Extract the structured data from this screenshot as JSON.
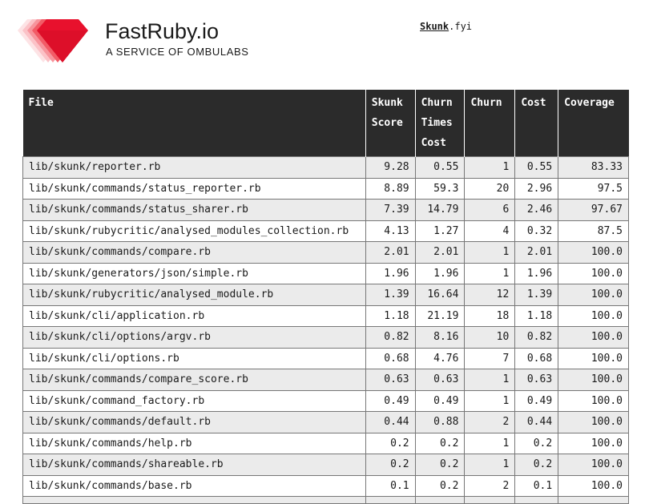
{
  "brand": {
    "name": "FastRuby.io",
    "tagline": "A SERVICE OF OMBULABS"
  },
  "nav": {
    "link_bold": "Skunk",
    "link_rest": ".fyi"
  },
  "table": {
    "headers": {
      "file": "File",
      "skunk_score": "Skunk Score",
      "churn_times_cost": "Churn Times Cost",
      "churn": "Churn",
      "cost": "Cost",
      "coverage": "Coverage"
    },
    "rows": [
      {
        "file": "lib/skunk/reporter.rb",
        "skunk_score": "9.28",
        "churn_times_cost": "0.55",
        "churn": "1",
        "cost": "0.55",
        "coverage": "83.33"
      },
      {
        "file": "lib/skunk/commands/status_reporter.rb",
        "skunk_score": "8.89",
        "churn_times_cost": "59.3",
        "churn": "20",
        "cost": "2.96",
        "coverage": "97.5"
      },
      {
        "file": "lib/skunk/commands/status_sharer.rb",
        "skunk_score": "7.39",
        "churn_times_cost": "14.79",
        "churn": "6",
        "cost": "2.46",
        "coverage": "97.67"
      },
      {
        "file": "lib/skunk/rubycritic/analysed_modules_collection.rb",
        "skunk_score": "4.13",
        "churn_times_cost": "1.27",
        "churn": "4",
        "cost": "0.32",
        "coverage": "87.5"
      },
      {
        "file": "lib/skunk/commands/compare.rb",
        "skunk_score": "2.01",
        "churn_times_cost": "2.01",
        "churn": "1",
        "cost": "2.01",
        "coverage": "100.0"
      },
      {
        "file": "lib/skunk/generators/json/simple.rb",
        "skunk_score": "1.96",
        "churn_times_cost": "1.96",
        "churn": "1",
        "cost": "1.96",
        "coverage": "100.0"
      },
      {
        "file": "lib/skunk/rubycritic/analysed_module.rb",
        "skunk_score": "1.39",
        "churn_times_cost": "16.64",
        "churn": "12",
        "cost": "1.39",
        "coverage": "100.0"
      },
      {
        "file": "lib/skunk/cli/application.rb",
        "skunk_score": "1.18",
        "churn_times_cost": "21.19",
        "churn": "18",
        "cost": "1.18",
        "coverage": "100.0"
      },
      {
        "file": "lib/skunk/cli/options/argv.rb",
        "skunk_score": "0.82",
        "churn_times_cost": "8.16",
        "churn": "10",
        "cost": "0.82",
        "coverage": "100.0"
      },
      {
        "file": "lib/skunk/cli/options.rb",
        "skunk_score": "0.68",
        "churn_times_cost": "4.76",
        "churn": "7",
        "cost": "0.68",
        "coverage": "100.0"
      },
      {
        "file": "lib/skunk/commands/compare_score.rb",
        "skunk_score": "0.63",
        "churn_times_cost": "0.63",
        "churn": "1",
        "cost": "0.63",
        "coverage": "100.0"
      },
      {
        "file": "lib/skunk/command_factory.rb",
        "skunk_score": "0.49",
        "churn_times_cost": "0.49",
        "churn": "1",
        "cost": "0.49",
        "coverage": "100.0"
      },
      {
        "file": "lib/skunk/commands/default.rb",
        "skunk_score": "0.44",
        "churn_times_cost": "0.88",
        "churn": "2",
        "cost": "0.44",
        "coverage": "100.0"
      },
      {
        "file": "lib/skunk/commands/help.rb",
        "skunk_score": "0.2",
        "churn_times_cost": "0.2",
        "churn": "1",
        "cost": "0.2",
        "coverage": "100.0"
      },
      {
        "file": "lib/skunk/commands/shareable.rb",
        "skunk_score": "0.2",
        "churn_times_cost": "0.2",
        "churn": "1",
        "cost": "0.2",
        "coverage": "100.0"
      },
      {
        "file": "lib/skunk/commands/base.rb",
        "skunk_score": "0.1",
        "churn_times_cost": "0.2",
        "churn": "2",
        "cost": "0.1",
        "coverage": "100.0"
      }
    ]
  }
}
